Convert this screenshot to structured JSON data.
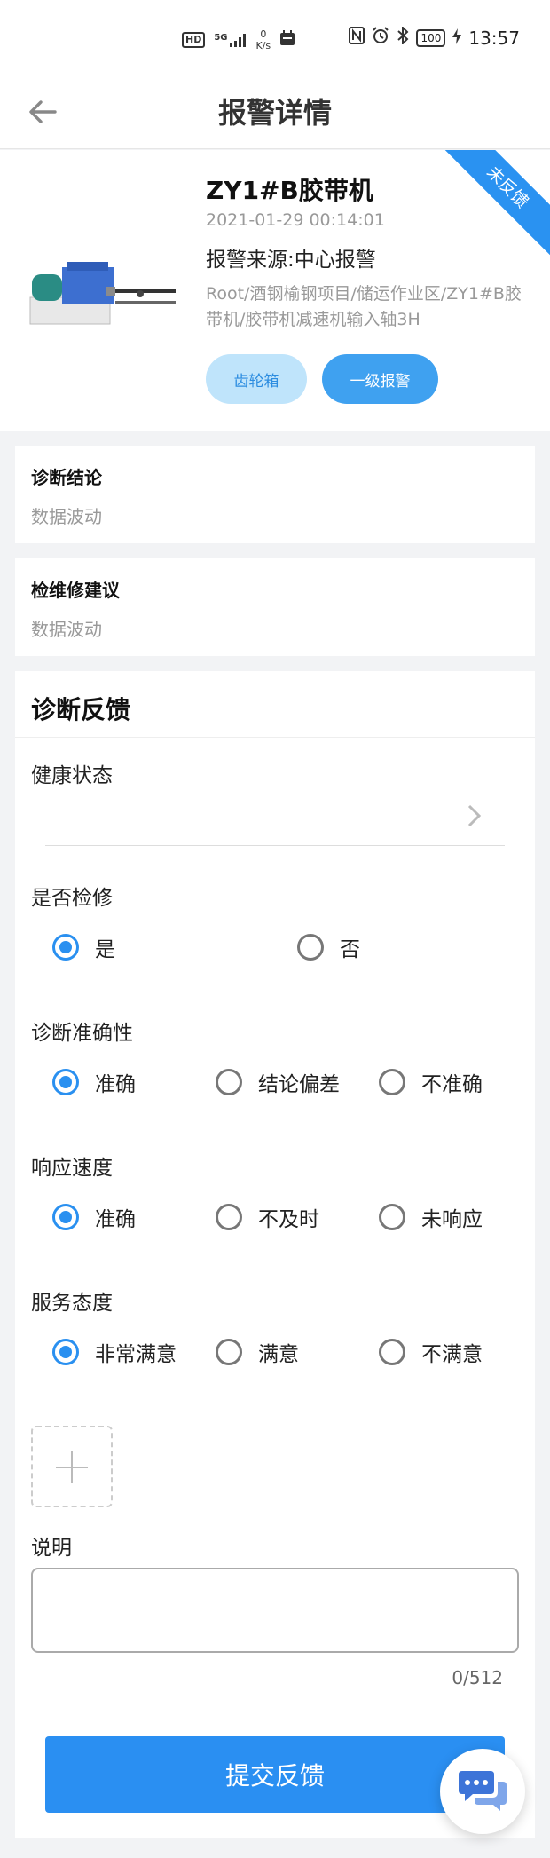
{
  "status_bar": {
    "hd": "HD",
    "network_type": "5G",
    "speed_value": "0",
    "speed_unit": "K/s",
    "battery": "100",
    "time": "13:57"
  },
  "titlebar": {
    "title": "报警详情",
    "back_icon": "arrow-left-icon"
  },
  "alarm": {
    "device_name": "ZY1#B胶带机",
    "time": "2021-01-29 00:14:01",
    "source": "报警来源:中心报警",
    "path": "Root/酒钢榆钢项目/储运作业区/ZY1#B胶带机/胶带机减速机输入轴3H",
    "tag_component": "齿轮箱",
    "tag_level": "一级报警",
    "ribbon": "未反馈",
    "colors": {
      "accent": "#2a8ff2",
      "tag_light_bg": "#bfe4fb"
    }
  },
  "diagnosis": {
    "title": "诊断结论",
    "value": "数据波动"
  },
  "maintenance": {
    "title": "检维修建议",
    "value": "数据波动"
  },
  "feedback": {
    "title": "诊断反馈",
    "health_label": "健康状态",
    "repair": {
      "label": "是否检修",
      "options": [
        {
          "label": "是",
          "selected": true
        },
        {
          "label": "否",
          "selected": false
        }
      ]
    },
    "accuracy": {
      "label": "诊断准确性",
      "options": [
        {
          "label": "准确",
          "selected": true
        },
        {
          "label": "结论偏差",
          "selected": false
        },
        {
          "label": "不准确",
          "selected": false
        }
      ]
    },
    "response": {
      "label": "响应速度",
      "options": [
        {
          "label": "准确",
          "selected": true
        },
        {
          "label": "不及时",
          "selected": false
        },
        {
          "label": "未响应",
          "selected": false
        }
      ]
    },
    "attitude": {
      "label": "服务态度",
      "options": [
        {
          "label": "非常满意",
          "selected": true
        },
        {
          "label": "满意",
          "selected": false
        },
        {
          "label": "不满意",
          "selected": false
        }
      ]
    },
    "description_label": "说明",
    "description_value": "",
    "counter": "0/512",
    "submit_label": "提交反馈"
  }
}
